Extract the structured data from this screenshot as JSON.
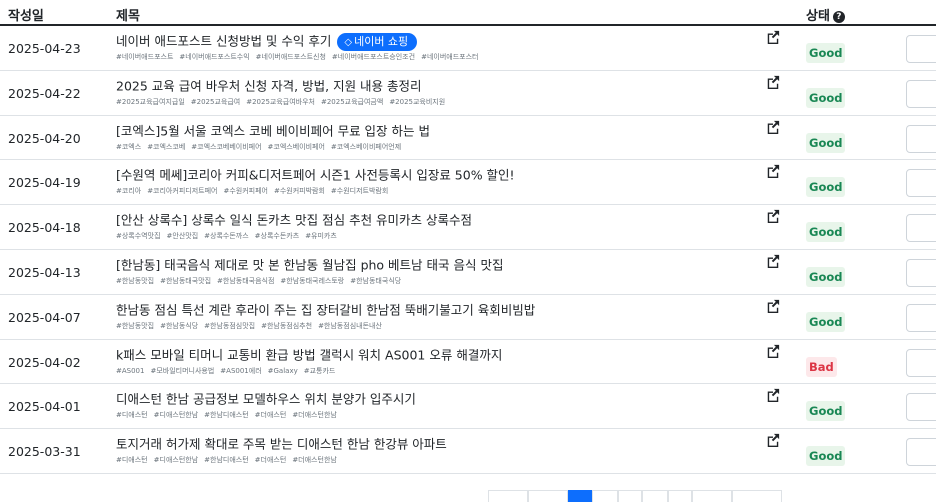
{
  "table": {
    "headers": {
      "date": "작성일",
      "title": "제목",
      "status": "상태"
    },
    "rows": [
      {
        "date": "2025-04-23",
        "title": "네이버 애드포스트 신청방법 및 수익 후기",
        "chip": "네이버 쇼핑",
        "tags": [
          "#네이버애드포스트",
          "#네이버애드포스트수익",
          "#네이버애드포스트신청",
          "#네이버애드포스트승인조건",
          "#네이버애드포스터"
        ],
        "status": "Good"
      },
      {
        "date": "2025-04-22",
        "title": "2025 교육 급여 바우처 신청 자격, 방법, 지원 내용 총정리",
        "tags": [
          "#2025교육급여지급일",
          "#2025교육급여",
          "#2025교육급여바우처",
          "#2025교육급여금액",
          "#2025교육비지원"
        ],
        "status": "Good"
      },
      {
        "date": "2025-04-20",
        "title": "[코엑스]5월 서울 코엑스 코베 베이비페어 무료 입장 하는 법",
        "tags": [
          "#코엑스",
          "#코엑스코베",
          "#코엑스코베베이비페어",
          "#코엑스베이비페어",
          "#코엑스베이비페어언제"
        ],
        "status": "Good"
      },
      {
        "date": "2025-04-19",
        "title": "[수원역 메쎄]코리아 커피&디저트페어 시즌1 사전등록시 입장료 50% 할인!",
        "tags": [
          "#코리아",
          "#코리아커피디저트페어",
          "#수원커피페어",
          "#수원커피박람회",
          "#수원디저트박람회"
        ],
        "status": "Good"
      },
      {
        "date": "2025-04-18",
        "title": "[안산 상록수] 상록수 일식 돈카츠 맛집 점심 추천 유미카츠 상록수점",
        "tags": [
          "#상록수역맛집",
          "#안산맛집",
          "#상록수돈까스",
          "#상록수돈카츠",
          "#유미카츠"
        ],
        "status": "Good"
      },
      {
        "date": "2025-04-13",
        "title": "[한남동] 태국음식 제대로 맛 본 한남동 월남집 pho 베트남 태국 음식 맛집",
        "tags": [
          "#한남동맛집",
          "#한남동태국맛집",
          "#한남동태국음식점",
          "#한남동태국레스토랑",
          "#한남동태국식당"
        ],
        "status": "Good"
      },
      {
        "date": "2025-04-07",
        "title": "한남동 점심 특선 계란 후라이 주는 집 장터갈비 한남점 뚝배기불고기 육회비빔밥",
        "tags": [
          "#한남동맛집",
          "#한남동식당",
          "#한남동점심맛집",
          "#한남동점심추천",
          "#한남동점심내돈내산"
        ],
        "status": "Good"
      },
      {
        "date": "2025-04-02",
        "title": "k패스 모바일 티머니 교통비 환급 방법 갤럭시 워치 AS001 오류 해결까지",
        "tags": [
          "#AS001",
          "#모바일티머니사용법",
          "#AS001에러",
          "#Galaxy",
          "#교통카드"
        ],
        "status": "Bad"
      },
      {
        "date": "2025-04-01",
        "title": "디애스턴 한남 공급정보 모델하우스 위치 분양가 입주시기",
        "tags": [
          "#디애스턴",
          "#디애스턴한남",
          "#한남디애스턴",
          "#더애스턴",
          "#더애스턴한남"
        ],
        "status": "Good"
      },
      {
        "date": "2025-03-31",
        "title": "토지거래 허가제 확대로 주목 받는 디애스턴 한남 한강뷰 아파트",
        "tags": [
          "#디애스턴",
          "#디애스턴한남",
          "#한남디애스턴",
          "#더애스턴",
          "#더애스턴한남"
        ],
        "status": "Good"
      }
    ]
  },
  "colors": {
    "accent": "#0d6efd",
    "good": "#198754",
    "bad": "#dc3545"
  },
  "icons": {
    "help": "question-circle-icon",
    "external": "external-link-icon",
    "chip": "tag-icon"
  }
}
